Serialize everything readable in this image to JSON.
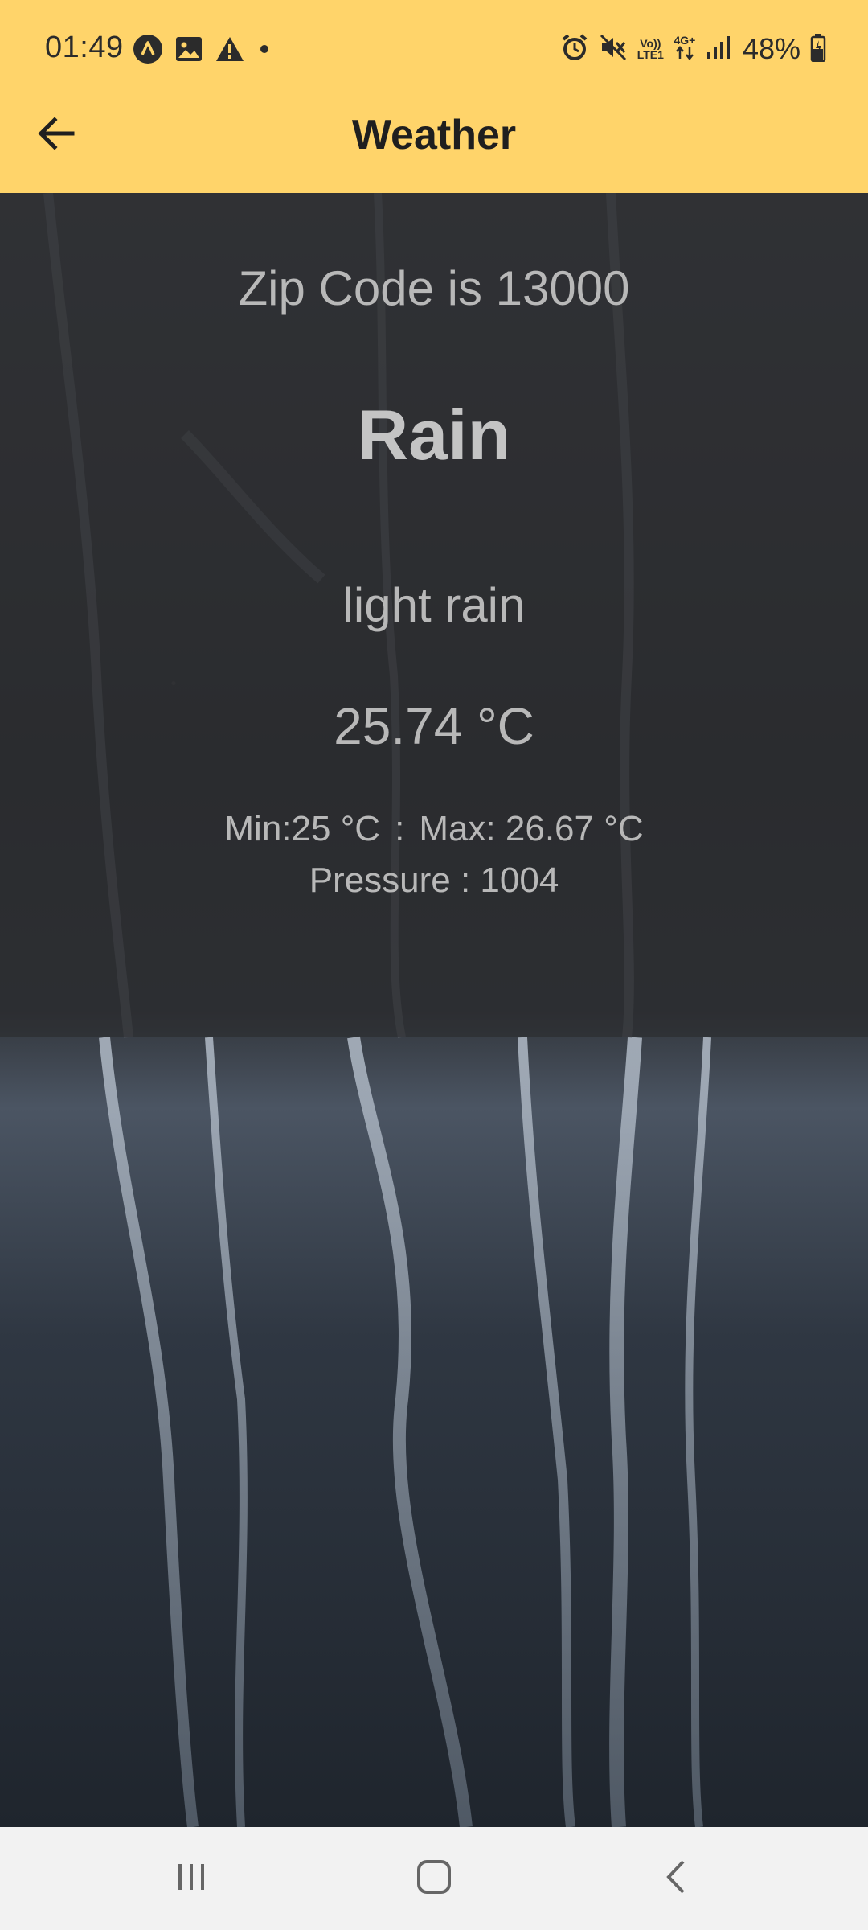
{
  "status_bar": {
    "time": "01:49",
    "battery": "48%",
    "volte_label_top": "Vo))",
    "volte_label_bottom": "LTE1",
    "network_label": "4G+",
    "icons": [
      "circle-a-icon",
      "image-icon",
      "warning-icon",
      "dot-icon",
      "alarm-icon",
      "mute-icon",
      "volte-icon",
      "data-arrows-icon",
      "signal-icon",
      "battery-icon"
    ]
  },
  "app_bar": {
    "title": "Weather",
    "back_icon": "arrow-left-icon"
  },
  "weather": {
    "zip_text": "Zip Code is 13000",
    "main": "Rain",
    "description": "light rain",
    "temperature": "25.74 °C",
    "min": "Min:25 °C",
    "separator": ":",
    "max": "Max: 26.67 °C",
    "pressure": "Pressure : 1004"
  },
  "nav_bar": {
    "icons": [
      "recents-icon",
      "home-icon",
      "back-icon"
    ]
  },
  "colors": {
    "app_bar": "#ffd46a",
    "nav_bar": "#f2f2f2",
    "text": "#b8b8b8"
  }
}
